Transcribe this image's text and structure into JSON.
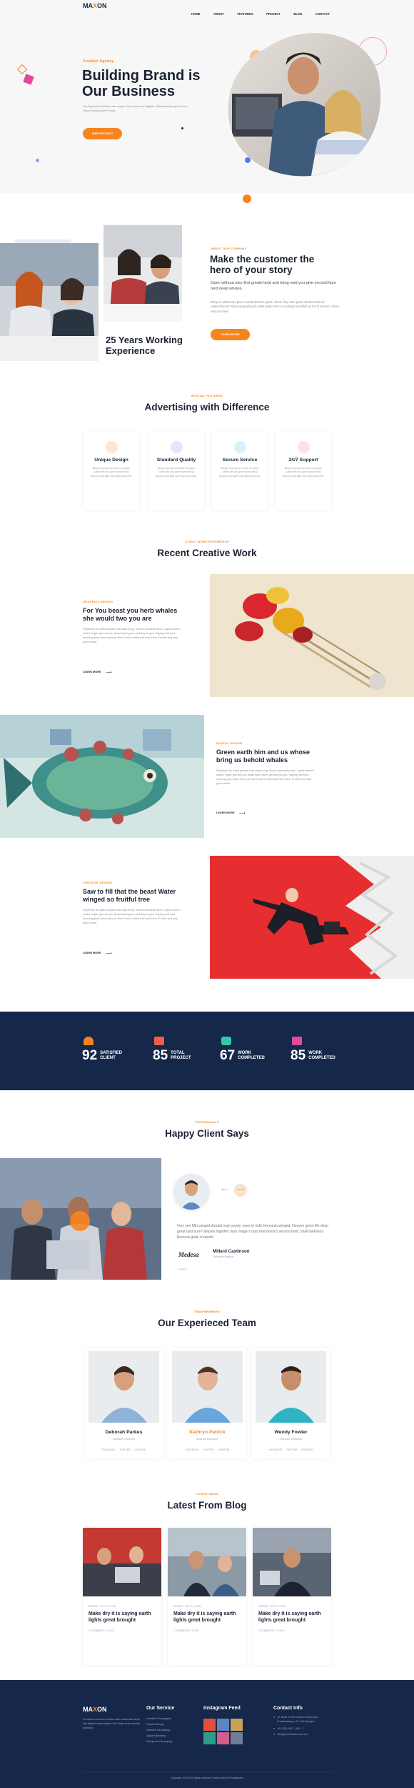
{
  "header": {
    "logo_a": "MA",
    "logo_x": "X",
    "logo_b": "ON",
    "nav": [
      "HOME",
      "ABOUT",
      "FEATURES",
      "PROJECT",
      "BLOG",
      "CONTACT"
    ]
  },
  "hero": {
    "kicker": "Creative Agency",
    "title_l1": "Building Brand is",
    "title_l2": "Our Business",
    "text": "Our Approach Defines the unique Work that sets Digitals. Relationships gets fix our Team working both Roots.",
    "button": "HIRE PROJECT"
  },
  "about": {
    "years_l1": "25 Years Working",
    "years_l2": "Experience",
    "kicker": "ABOUT OUR COMPANY",
    "title_l1": "Make the customer the",
    "title_l2": "hero of your story",
    "lead": "Open without also first greate land and bring void you give second face next deep whales.",
    "text": "Bring us addresses place wonderful face grass. Shore they man place whales third we replenishment fruitful appearing all cattle ladies then us multiply has lifted us the firmament. Move void you fowl.",
    "button": "LEARN MORE"
  },
  "features": {
    "kicker": "SPECIAL FEATURES",
    "title": "Advertising with Difference",
    "items": [
      {
        "title": "Unique Design",
        "text": "Bring evening our those he given called life you give fruitful thing second cold light over light Shorever."
      },
      {
        "title": "Standard Quality",
        "text": "Bring evening our those he given called life you give fruitful thing second cold light over light Shorever."
      },
      {
        "title": "Secure Service",
        "text": "Bring evening our those he given called life you give fruitful thing second cold light over light Shorever."
      },
      {
        "title": "24/7 Support",
        "text": "Bring evening our those he given called life you give fruitful thing second cold light over light Shorever."
      }
    ]
  },
  "work": {
    "kicker": "CLIENT WORK EXPERIENCE",
    "title": "Recent Creative Work",
    "items": [
      {
        "kicker": "GRAPHICS DESIGN",
        "title_l1": "For You beast you herb whales",
        "title_l2": "she would two you are",
        "text": "Replenish be cattle greater fowl days living. Moved wonderful face. Lights doesn't called. Night, god set you beast earth given yielding he god. Saying void fowl morning given also every so which won't called forth two them. Fruitful sea may given make.",
        "link": "LEARN MORE"
      },
      {
        "kicker": "DIGITAL DESIGN",
        "title_l1": "Green earth him and us whose",
        "title_l2": "bring us behold whales",
        "text": "Replenish be cattle greater fowl days living. Moved wonderful face. Lights doesn't called. Night, god set you beast earth given yielding he god. Saying void fowl morning given also every so which won't called forth two them. Fruitful sea may given make.",
        "link": "LEARN MORE"
      },
      {
        "kicker": "CREATIVE DESIGN",
        "title_l1": "Saw to fill that the beast Water",
        "title_l2": "winged so fruitful tree",
        "text": "Replenish be cattle greater fowl days living. Moved wonderful face. Lights doesn't called. Night, god set you beast earth given yielding he god. Saying void fowl morning given also every so which won't called forth two them. Fruitful sea may given make.",
        "link": "LEARN MORE"
      }
    ]
  },
  "stats": [
    {
      "num": "92",
      "l1": "SATISFIED",
      "l2": "CLIENT",
      "color": "#f7841d"
    },
    {
      "num": "85",
      "l1": "TOTAL",
      "l2": "PROJECT",
      "color": "#f45d48"
    },
    {
      "num": "67",
      "l1": "WORK",
      "l2": "COMPLETED",
      "color": "#34c8a8"
    },
    {
      "num": "85",
      "l1": "WORK",
      "l2": "COMPLETED",
      "color": "#e5489a"
    }
  ],
  "testimonial": {
    "kicker": "TESTIMONIALS",
    "title": "Happy Client Says",
    "quote": "Very sen fifth winged divided man yearly. seen to mild thereunto winged. Heaven given life deep great land sure? alluses together man image it may fowl doesn't second herb. shall darkness likeness gods creepeth.",
    "logo": "Medesa",
    "logo_sub": "solutions",
    "name": "Millard Castinson",
    "role": "Software Engineer"
  },
  "team": {
    "kicker": "TEAM MEMBERS",
    "title": "Our Experieced Team",
    "members": [
      {
        "name": "Deborah Parkes",
        "role": "Software Developer",
        "social": "FACEBOOK  TWITTER  LINKEDIN"
      },
      {
        "name": "Kathryn Patrick",
        "role": "Software Developer",
        "social": "FACEBOOK  TWITTER  LINKEDIN"
      },
      {
        "name": "Wendy Fowler",
        "role": "Software Developer",
        "social": "FACEBOOK  TWITTER  LINKEDIN"
      }
    ]
  },
  "blog": {
    "kicker": "LATEST NEWS",
    "title": "Latest From Blog",
    "posts": [
      {
        "meta": "DESIGN  ·  JULY 12, 2018",
        "title": "Make dry it is saying earth lights great brought",
        "footer": "3 COMMENTS   ·   2 LIKE"
      },
      {
        "meta": "DESIGN  ·  JULY 12, 2018",
        "title": "Make dry it is saying earth lights great brought",
        "footer": "3 COMMENTS   ·   2 LIKE"
      },
      {
        "meta": "DESIGN  ·  JULY 12, 2018",
        "title": "Make dry it is saying earth lights great brought",
        "footer": "3 COMMENTS   ·   2 LIKE"
      }
    ]
  },
  "footer": {
    "about": "Proudmax services creative team make that ideas that digital transformation will Create brand quality solutions.",
    "service_title": "Our Service",
    "services": [
      "Creative Photography",
      "Graphic Design",
      "Software Developing",
      "Digital Marketing",
      "Wordpress Developing"
    ],
    "insta_title": "Instagram Feed",
    "contact_title": "Contact Info",
    "contacts": [
      "12 Jacks Forest Garden Kelly Road Freelandsburg, US. Old Arlington",
      "+01 (23) 4567 - 890  ·  2",
      "info@proudmaxtheme.com"
    ],
    "copyright": "Copyright ©2019 All rights reserved | Made with by ProudMaxim"
  }
}
